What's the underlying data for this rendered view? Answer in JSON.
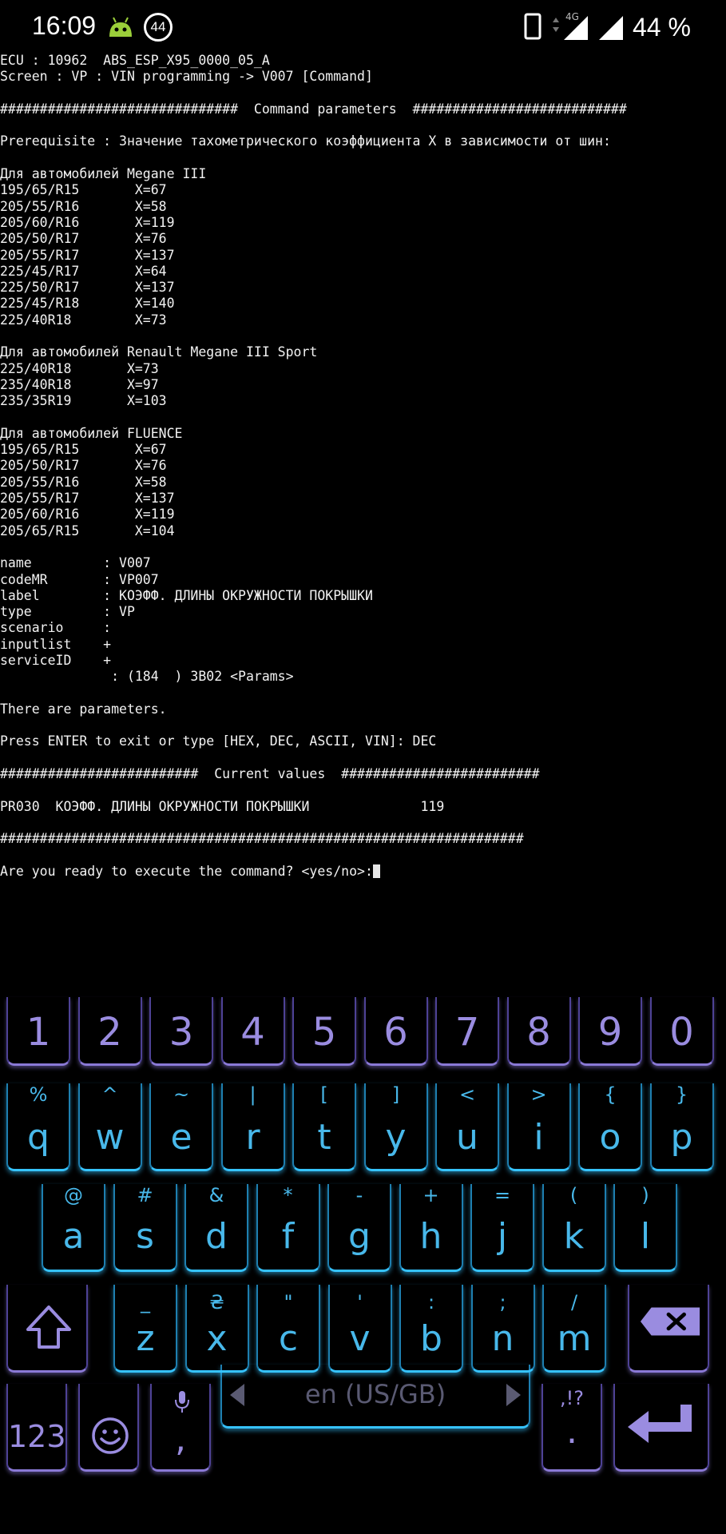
{
  "status_bar": {
    "time": "16:09",
    "notification_count": "44",
    "network_type": "4G",
    "battery": "44 %",
    "icons": [
      "android-debug-icon",
      "phone-icon",
      "signal-4g-icon",
      "signal-icon"
    ]
  },
  "terminal": {
    "lines": [
      "ECU : 10962  ABS_ESP_X95_0000_05_A",
      "Screen : VP : VIN programming -> V007 [Command]",
      "",
      "##############################  Command parameters  ###########################",
      "",
      "Prerequisite : Значение тахометрического коэффициента X в зависимости от шин:",
      "",
      "Для автомобилей Megane III",
      "195/65/R15       X=67",
      "205/55/R16       X=58",
      "205/60/R16       X=119",
      "205/50/R17       X=76",
      "205/55/R17       X=137",
      "225/45/R17       X=64",
      "225/50/R17       X=137",
      "225/45/R18       X=140",
      "225/40R18        X=73",
      "",
      "Для автомобилей Renault Megane III Sport",
      "225/40R18       X=73",
      "235/40R18       X=97",
      "235/35R19       X=103",
      "",
      "Для автомобилей FLUENCE",
      "195/65/R15       X=67",
      "205/50/R17       X=76",
      "205/55/R16       X=58",
      "205/55/R17       X=137",
      "205/60/R16       X=119",
      "205/65/R15       X=104",
      "",
      "name         : V007",
      "codeMR       : VP007",
      "label        : КОЭФФ. ДЛИНЫ ОКРУЖНОСТИ ПОКРЫШКИ",
      "type         : VP",
      "scenario     :",
      "inputlist    +",
      "serviceID    +",
      "              : (184  ) 3B02 <Params>",
      "",
      "There are parameters.",
      "",
      "Press ENTER to exit or type [HEX, DEC, ASCII, VIN]: DEC",
      "",
      "#########################  Current values  #########################",
      "",
      "PR030  КОЭФФ. ДЛИНЫ ОКРУЖНОСТИ ПОКРЫШКИ              119",
      "",
      "##################################################################",
      ""
    ],
    "prompt": "Are you ready to execute the command? <yes/no>:"
  },
  "keyboard": {
    "digits": [
      "1",
      "2",
      "3",
      "4",
      "5",
      "6",
      "7",
      "8",
      "9",
      "0"
    ],
    "row1": [
      {
        "key": "q",
        "alt": "%"
      },
      {
        "key": "w",
        "alt": "^"
      },
      {
        "key": "e",
        "alt": "~"
      },
      {
        "key": "r",
        "alt": "|"
      },
      {
        "key": "t",
        "alt": "["
      },
      {
        "key": "y",
        "alt": "]"
      },
      {
        "key": "u",
        "alt": "<"
      },
      {
        "key": "i",
        "alt": ">"
      },
      {
        "key": "o",
        "alt": "{"
      },
      {
        "key": "p",
        "alt": "}"
      }
    ],
    "row2": [
      {
        "key": "a",
        "alt": "@"
      },
      {
        "key": "s",
        "alt": "#"
      },
      {
        "key": "d",
        "alt": "&"
      },
      {
        "key": "f",
        "alt": "*"
      },
      {
        "key": "g",
        "alt": "-"
      },
      {
        "key": "h",
        "alt": "+"
      },
      {
        "key": "j",
        "alt": "="
      },
      {
        "key": "k",
        "alt": "("
      },
      {
        "key": "l",
        "alt": ")"
      }
    ],
    "row3": [
      {
        "key": "z",
        "alt": "_"
      },
      {
        "key": "x",
        "alt": "₴"
      },
      {
        "key": "c",
        "alt": "\""
      },
      {
        "key": "v",
        "alt": "'"
      },
      {
        "key": "b",
        "alt": ":"
      },
      {
        "key": "n",
        "alt": ";"
      },
      {
        "key": "m",
        "alt": "/"
      }
    ],
    "symbols_key": "123",
    "comma_key": ",",
    "period_key": ".",
    "period_alt": ",!?",
    "space_label": "en (US/GB)",
    "colors": {
      "cyan": "#36c3ff",
      "purple": "#8a79d6"
    }
  }
}
